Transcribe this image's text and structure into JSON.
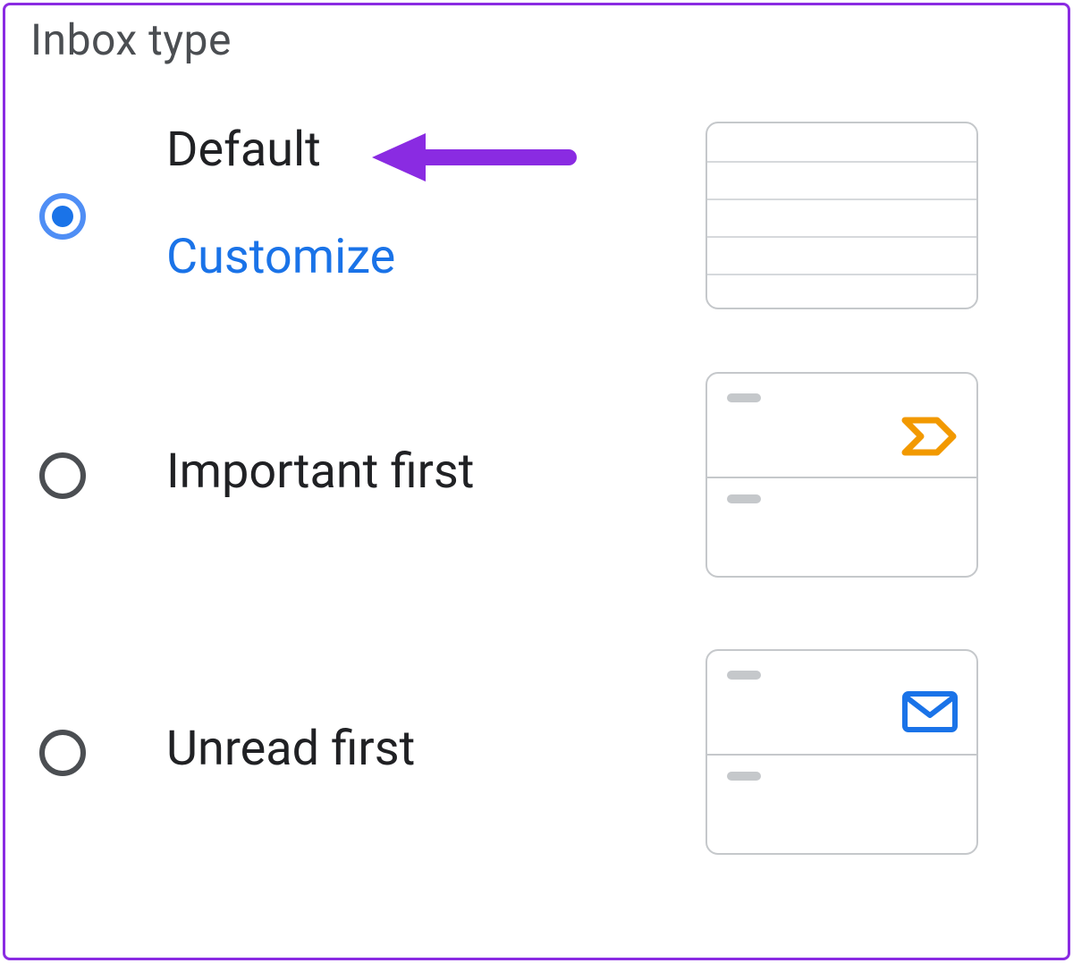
{
  "title": "Inbox type",
  "options": [
    {
      "label": "Default",
      "sublink": "Customize",
      "selected": true
    },
    {
      "label": "Important first",
      "selected": false
    },
    {
      "label": "Unread first",
      "selected": false
    }
  ],
  "colors": {
    "accent": "#1a73e8",
    "annotation": "#8a2be2",
    "important_icon": "#f29900",
    "unread_icon": "#1a73e8"
  }
}
